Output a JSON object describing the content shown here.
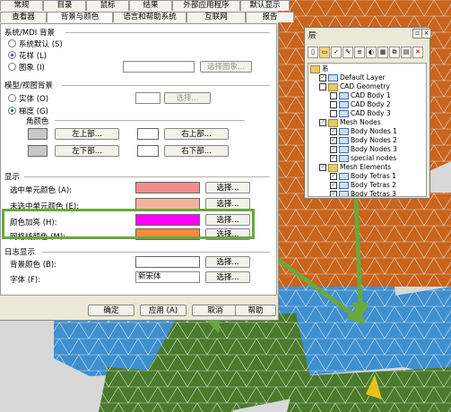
{
  "dialog": {
    "tabs_row1": [
      "常规",
      "目录",
      "鼠标",
      "结果",
      "外部应用程序",
      "默认显示"
    ],
    "tabs_row2": [
      "查看器",
      "背景与颜色",
      "语言和帮助系统",
      "互联网",
      "报告"
    ],
    "sections": {
      "background": {
        "title": "系统/MDI 背景",
        "option_default": "系统默认 (S)",
        "option_pattern": "花样 (L)",
        "option_image": "图象 (I)",
        "select_image": "选择图象..."
      },
      "model_bg": {
        "title": "模型/视图背景",
        "option_solid": "实体 (O)",
        "option_gradient": "梯度 (G)",
        "choose": "选择...",
        "corner_title": "角颜色",
        "top_left": "左上部...",
        "top_right": "右上部...",
        "bottom_left": "左下部...",
        "bottom_right": "右下部..."
      },
      "display": {
        "title": "显示",
        "selected_elem": "选中单元颜色 (A):",
        "unselected_elem": "未选中单元颜色 (E):",
        "highlight": "颜色加亮 (H):",
        "grid_line": "网格线颜色 (M):",
        "choose": "选择..."
      },
      "log": {
        "title": "日志显示",
        "bg_color": "背景颜色 (B):",
        "font": "字体 (F):",
        "font_value": "新宋体",
        "choose": "选择..."
      }
    },
    "buttons": {
      "ok": "确定",
      "apply": "应用 (A)",
      "cancel": "取消",
      "help": "帮助"
    },
    "colors": {
      "selected": "#f08d8d",
      "unselected": "#f3b49f",
      "highlight": "#ff00ff",
      "grid": "#ff8a3a",
      "corner": "#c8c8c8"
    }
  },
  "layer_panel": {
    "title": "层",
    "root": "系",
    "nodes": [
      "Default Layer",
      "CAD Geometry",
      "CAD Body 1",
      "CAD Body 2",
      "CAD Body 3",
      "Mesh Nodes",
      "Body Nodes 1",
      "Body Nodes 2",
      "Body Nodes 3",
      "special nodes",
      "Mesh Elements",
      "Body Tetras 1",
      "Body Tetras 2",
      "Body Tetras 3"
    ]
  }
}
